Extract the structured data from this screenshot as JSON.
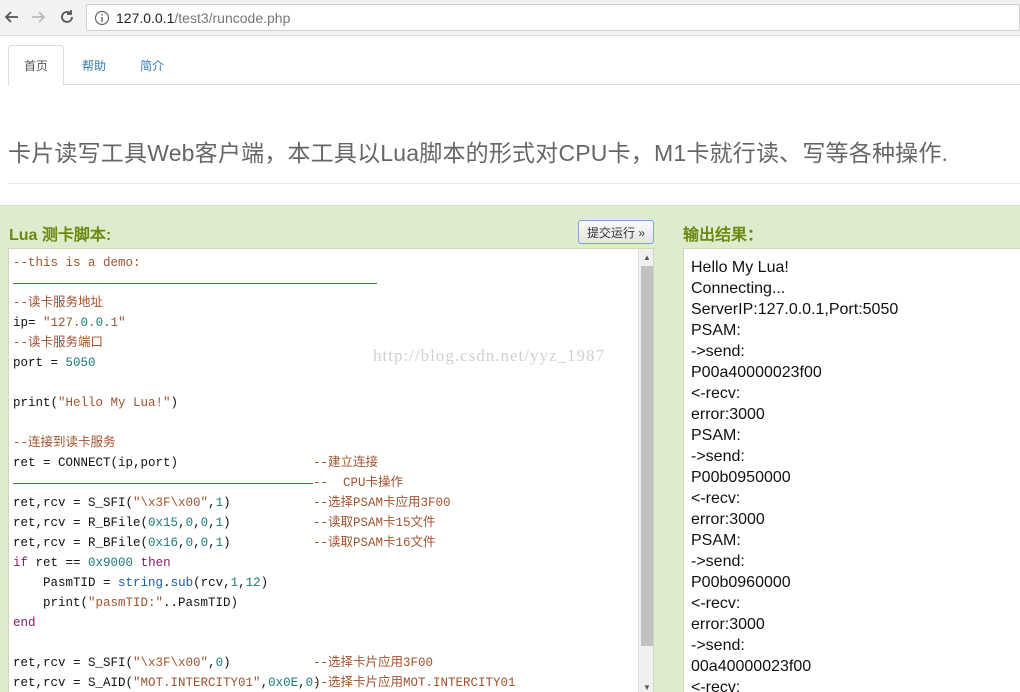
{
  "browser": {
    "back_icon": "back-arrow-icon",
    "forward_icon": "forward-arrow-icon",
    "reload_icon": "reload-icon",
    "url_host": "127.0.0.1",
    "url_path": "/test3/runcode.php"
  },
  "tabs": [
    {
      "label": "首页",
      "active": true
    },
    {
      "label": "帮助",
      "active": false
    },
    {
      "label": "简介",
      "active": false
    }
  ],
  "page": {
    "title": "卡片读写工具Web客户端，本工具以Lua脚本的形式对CPU卡，M1卡就行读、写等各种操作."
  },
  "script_panel": {
    "label": "Lua 测卡脚本:",
    "run_button": "提交运行 »"
  },
  "output_panel": {
    "label": "输出结果："
  },
  "watermark": "http://blog.csdn.net/yyz_1987",
  "code_lines": [
    "--this is a demo:",
    "",
    "--读卡服务地址",
    "ip= \"127.0.0.1\"",
    "--读卡服务端口",
    "port = 5050",
    "",
    "print(\"Hello My Lua!\")",
    "",
    "--连接到读卡服务",
    "ret = CONNECT(ip,port)",
    "--  CPU卡操作",
    "ret,rcv = S_SFI(\"\\x3F\\x00\",1)",
    "ret,rcv = R_BFile(0x15,0,0,1)",
    "ret,rcv = R_BFile(0x16,0,0,1)",
    "if ret == 0x9000 then",
    "    PasmTID = string.sub(rcv,1,12)",
    "    print(\"pasmTID:\"..PasmTID)",
    "end",
    "",
    "ret,rcv = S_SFI(\"\\x3F\\x00\",0)",
    "ret,rcv = S_AID(\"MOT.INTERCITY01\",0x0E,0)"
  ],
  "code_comments": {
    "c10": "--建立连接",
    "c12": "--选择PSAM卡应用3F00",
    "c13": "--读取PSAM卡15文件",
    "c14": "--读取PSAM卡16文件",
    "c20": "--选择卡片应用3F00",
    "c21": "--选择卡片应用MOT.INTERCITY01"
  },
  "output_lines": [
    "Hello My Lua!",
    "Connecting...",
    "ServerIP:127.0.0.1,Port:5050",
    "PSAM:",
    "->send:",
    "P00a40000023f00",
    "<-recv:",
    "error:3000",
    "PSAM:",
    "->send:",
    "P00b0950000",
    "<-recv:",
    "error:3000",
    "PSAM:",
    "->send:",
    "P00b0960000",
    "<-recv:",
    "error:3000",
    "->send:",
    "00a40000023f00",
    "<-recv:"
  ]
}
